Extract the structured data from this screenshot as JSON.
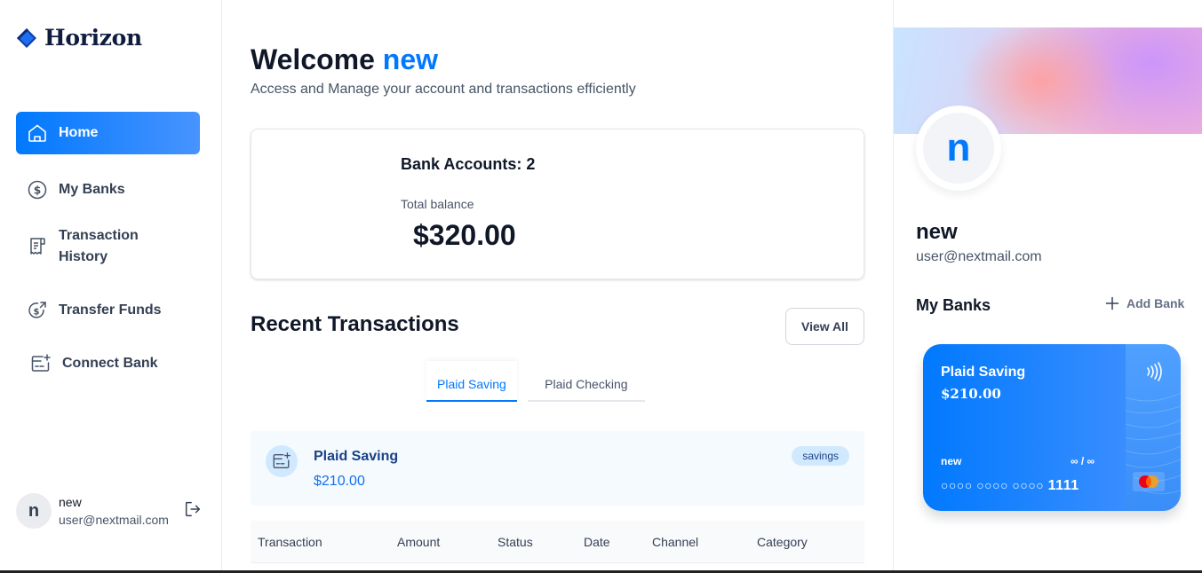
{
  "brand": {
    "name": "Horizon"
  },
  "sidebar": {
    "items": [
      {
        "label": "Home",
        "icon": "home-icon",
        "active": true
      },
      {
        "label": "My Banks",
        "icon": "dollar-circle-icon"
      },
      {
        "label": "Transaction History",
        "icon": "receipt-icon"
      },
      {
        "label": "Transfer Funds",
        "icon": "money-send-icon"
      },
      {
        "label": "Connect Bank",
        "icon": "card-add-icon"
      }
    ],
    "user": {
      "initial": "n",
      "name": "new",
      "email": "user@nextmail.com"
    }
  },
  "header": {
    "welcome_prefix": "Welcome",
    "welcome_name": "new",
    "subtitle": "Access and Manage your account and transactions efficiently"
  },
  "balance": {
    "accounts_label": "Bank Accounts: 2",
    "total_label": "Total balance",
    "total_value": "$320.00"
  },
  "recent": {
    "title": "Recent Transactions",
    "view_all": "View All",
    "tabs": [
      "Plaid Saving",
      "Plaid Checking"
    ],
    "active_tab": 0,
    "account": {
      "name": "Plaid Saving",
      "balance": "$210.00",
      "type": "savings"
    },
    "columns": [
      "Transaction",
      "Amount",
      "Status",
      "Date",
      "Channel",
      "Category"
    ]
  },
  "profile": {
    "initial": "n",
    "name": "new",
    "email": "user@nextmail.com",
    "banks_title": "My Banks",
    "add_bank": "Add Bank"
  },
  "card": {
    "name": "Plaid Saving",
    "balance": "$210.00",
    "user": "new",
    "expiry": "∞ / ∞",
    "masked": "○○○○ ○○○○ ○○○○",
    "last4": "1111"
  },
  "colors": {
    "accent": "#0179fe",
    "text": "#101828",
    "muted": "#475467"
  }
}
